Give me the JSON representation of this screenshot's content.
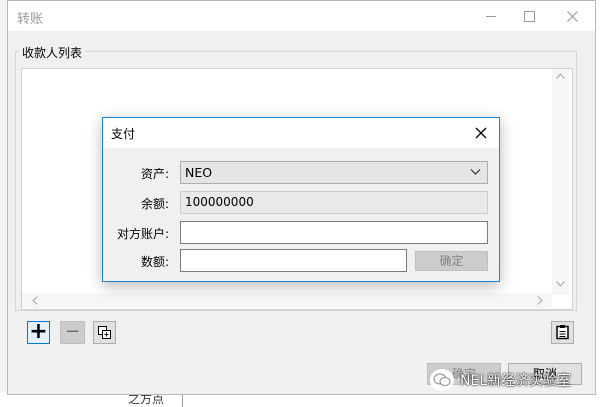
{
  "main_window": {
    "title": "转账",
    "group_label": "收款人列表",
    "bottom_left_text": "之方点"
  },
  "dialog": {
    "title": "支付",
    "fields": {
      "asset_label": "资产:",
      "asset_value": "NEO",
      "balance_label": "余额:",
      "balance_value": "100000000",
      "recipient_label": "对方账户:",
      "recipient_value": "",
      "amount_label": "数额:",
      "amount_value": ""
    },
    "confirm_label": "确定"
  },
  "toolbar": {
    "add_symbol": "+",
    "remove_symbol": "−"
  },
  "footer": {
    "ok_label": "确定",
    "cancel_label": "取消"
  },
  "watermark": {
    "text": "NEL新经济实验室"
  },
  "icons": [
    "close-icon",
    "minimize-icon",
    "maximize-icon",
    "chevron-down-icon",
    "copy-icon",
    "clipboard-icon",
    "wechat-icon"
  ],
  "colors": {
    "accent": "#0078d7",
    "dialog_border": "#1883d7"
  }
}
